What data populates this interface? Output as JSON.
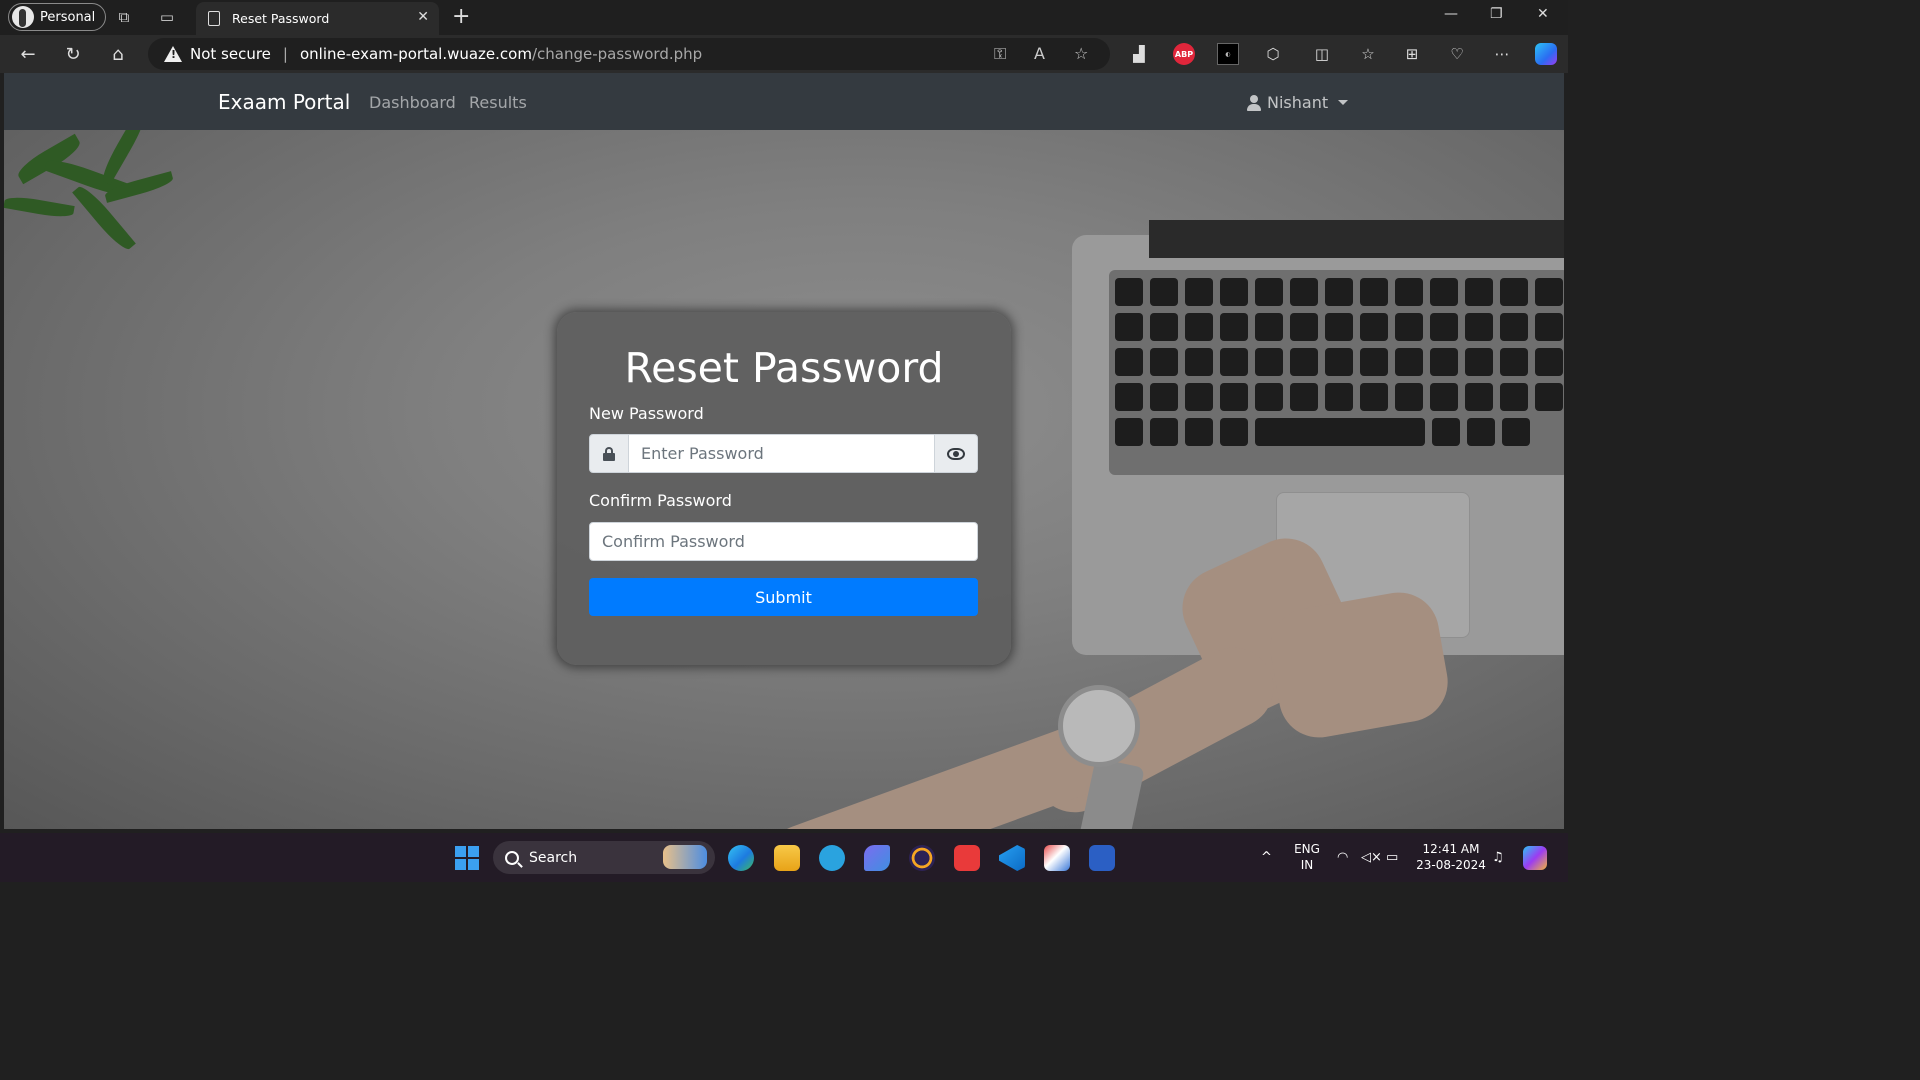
{
  "browser": {
    "profile_label": "Personal",
    "tab_title": "Reset Password",
    "security_label": "Not secure",
    "url_host": "online-exam-portal.wuaze.com",
    "url_path": "/change-password.php",
    "extensions": [
      "performance-icon",
      "adblock-plus-icon",
      "dark-reader-icon",
      "extensions-icon",
      "split-screen-icon",
      "favorites-icon",
      "collections-icon",
      "browser-essentials-icon",
      "more-icon",
      "copilot-icon"
    ]
  },
  "navbar": {
    "brand": "Exaam Portal",
    "links": [
      "Dashboard",
      "Results"
    ],
    "user": "Nishant"
  },
  "form": {
    "title": "Reset Password",
    "new_password_label": "New Password",
    "new_password_placeholder": "Enter Password",
    "confirm_password_label": "Confirm Password",
    "confirm_password_placeholder": "Confirm Password",
    "submit_label": "Submit"
  },
  "taskbar": {
    "search_label": "Search",
    "language": "ENG",
    "region": "IN",
    "time": "12:41 AM",
    "date": "23-08-2024"
  },
  "colors": {
    "primary": "#007bff",
    "navbar": "#343a40",
    "card": "#5f5f5f"
  }
}
